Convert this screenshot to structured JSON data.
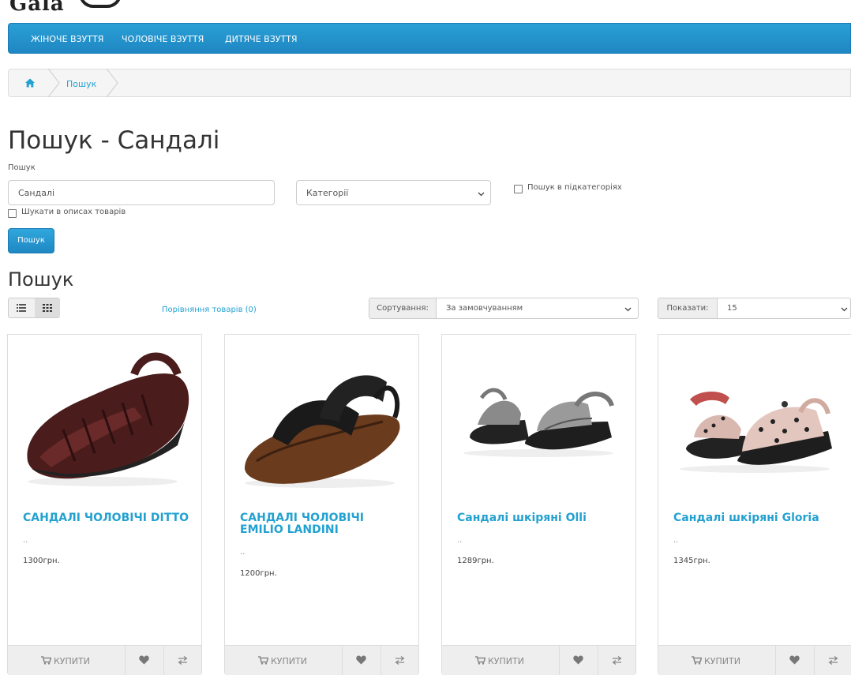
{
  "nav": {
    "items": [
      "ЖІНОЧЕ ВЗУТТЯ",
      "ЧОЛОВІЧЕ ВЗУТТЯ",
      "ДИТЯЧЕ ВЗУТТЯ"
    ]
  },
  "breadcrumb": {
    "home_icon": "home-icon",
    "crumb": "Пошук"
  },
  "page": {
    "title": "Пошук - Сандалі",
    "search_label": "Пошук",
    "search_value": "Сандалі",
    "category_value": "Категорії",
    "subcat_label": "Пошук в підкатегоріях",
    "desc_label": "Шукати в описах товарів",
    "search_button": "Пошук",
    "results_heading": "Пошук",
    "compare_link": "Порівняння товарів (0)",
    "sort_label": "Сортування:",
    "sort_value": "За замовчуванням",
    "limit_label": "Показати:",
    "limit_value": "15"
  },
  "colors": {
    "accent": "#23a1d1",
    "nav_bg": "#2a9fd6"
  },
  "products": [
    {
      "name": "САНДАЛІ ЧОЛОВІЧІ DITTO",
      "desc": "..",
      "price": "1300грн.",
      "buy": "КУПИТИ"
    },
    {
      "name": "САНДАЛІ ЧОЛОВІЧІ EMILIO LANDINI",
      "desc": "..",
      "price": "1200грн.",
      "buy": "КУПИТИ"
    },
    {
      "name": "Сандалі шкіряні Olli",
      "desc": "..",
      "price": "1289грн.",
      "buy": "КУПИТИ"
    },
    {
      "name": "Сандалі шкіряні Gloria",
      "desc": "..",
      "price": "1345грн.",
      "buy": "КУПИТИ"
    }
  ]
}
